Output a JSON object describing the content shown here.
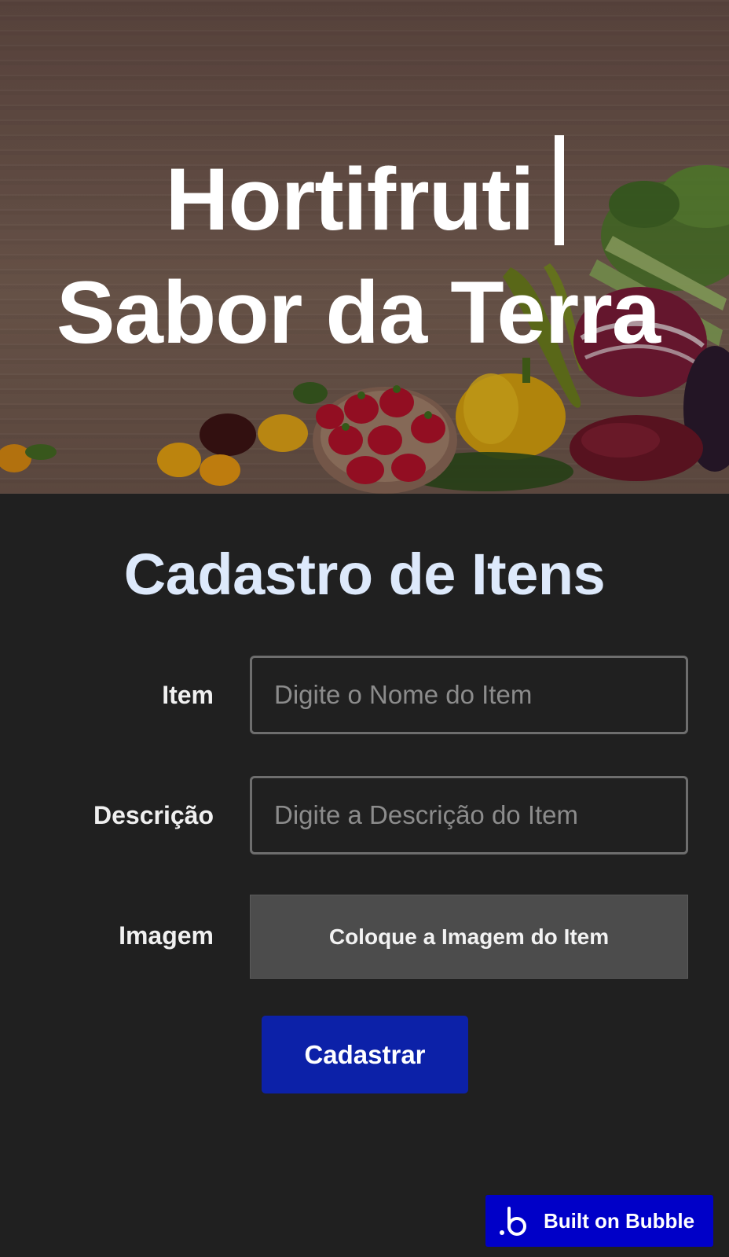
{
  "hero": {
    "title_line1": "Hortifruti",
    "title_line2": "Sabor da Terra"
  },
  "form": {
    "title": "Cadastro de Itens",
    "item": {
      "label": "Item",
      "placeholder": "Digite o Nome do Item",
      "value": ""
    },
    "description": {
      "label": "Descrição",
      "placeholder": "Digite a Descrição do Item",
      "value": ""
    },
    "image": {
      "label": "Imagem",
      "button_label": "Coloque a Imagem do Item"
    },
    "submit_label": "Cadastrar"
  },
  "badge": {
    "label": "Built on Bubble",
    "icon": "bubble-logo-icon"
  },
  "colors": {
    "background": "#202020",
    "title_color": "#dde9fb",
    "submit_button": "#0c21a8",
    "badge_background": "#0000c8",
    "upload_background": "#4c4c4c"
  }
}
